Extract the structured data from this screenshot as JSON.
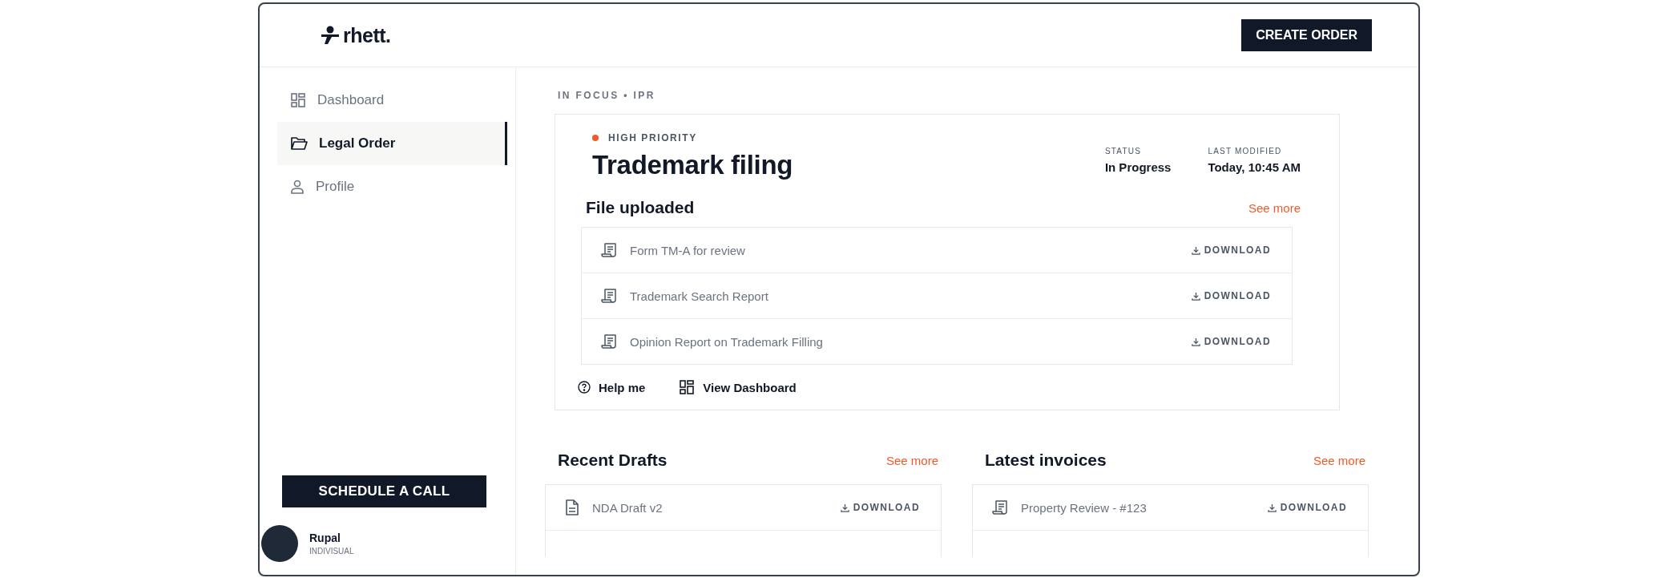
{
  "logo": {
    "text": "rhett."
  },
  "header": {
    "action": "CREATE ORDER"
  },
  "sidebar": {
    "items": [
      {
        "label": "Dashboard",
        "kind": "grid",
        "selected": false
      },
      {
        "label": "Legal Order",
        "kind": "folder",
        "selected": true
      },
      {
        "label": "Profile",
        "kind": "person",
        "selected": false
      }
    ],
    "schedule_button": "SCHEDULE A CALL",
    "user": {
      "name": "Rupal",
      "role": "INDIVISUAL"
    }
  },
  "focus": {
    "eyebrow": "IN FOCUS • IPR",
    "priority": "HIGH PRIORITY",
    "title": "Trademark filing",
    "meta": [
      {
        "label": "STATUS",
        "value": "In Progress"
      },
      {
        "label": "LAST MODIFIED",
        "value": "Today, 10:45 AM"
      }
    ],
    "files_heading": "File uploaded",
    "see_more": "See more",
    "files": [
      {
        "name": "Form TM-A for review",
        "kind": "receipt",
        "action": "DOWNLOAD"
      },
      {
        "name": "Trademark Search Report",
        "kind": "receipt",
        "action": "DOWNLOAD"
      },
      {
        "name": "Opinion Report on Trademark Filling",
        "kind": "receipt",
        "action": "DOWNLOAD"
      }
    ],
    "links": [
      {
        "label": "Help me",
        "kind": "help"
      },
      {
        "label": "View Dashboard",
        "kind": "grid"
      }
    ]
  },
  "sections": [
    {
      "title": "Recent Drafts",
      "see_more": "See more",
      "items": [
        {
          "name": "NDA Draft v2",
          "kind": "document",
          "action": "DOWNLOAD"
        }
      ]
    },
    {
      "title": "Latest invoices",
      "see_more": "See more",
      "items": [
        {
          "name": "Property Review - #123",
          "kind": "receipt",
          "action": "DOWNLOAD"
        }
      ]
    }
  ]
}
